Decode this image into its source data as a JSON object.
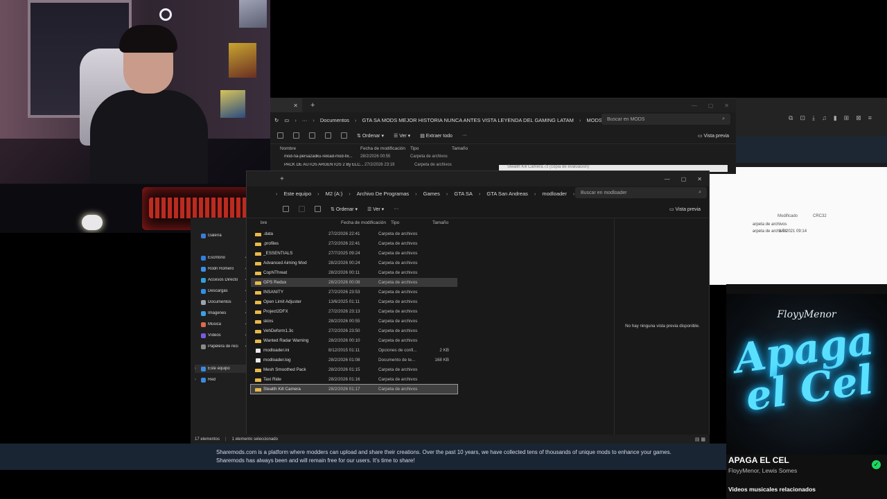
{
  "mods_window": {
    "breadcrumb": [
      "Documentos",
      "GTA SA MODS MEJOR HISTORIA NUNCA ANTES VISTA LEYENDA DEL GAMING LATAM",
      "MODS"
    ],
    "search_placeholder": "Buscar en MODS",
    "cmd": {
      "sort": "Ordenar",
      "view": "Ver",
      "extract": "Extraer todo",
      "preview": "Vista previa"
    },
    "columns": [
      "Nombre",
      "Fecha de modificación",
      "Tipo",
      "Tamaño"
    ],
    "rows": [
      {
        "name": "mod-na-persazadku-reload-mod-fix...",
        "date": "28/2/2026 00:55",
        "type": "Carpeta de archivos"
      },
      {
        "name": "PACK DE AUTOS ARGENTOS 2 By ELC...",
        "date": "27/2/2026 23:19",
        "type": "Carpeta de archivos"
      }
    ]
  },
  "modloader_window": {
    "new_tab": "+",
    "breadcrumb": [
      "Este equipo",
      "M2 (A:)",
      "Archivo De Programas",
      "Games",
      "GTA SA",
      "GTA San Andreas",
      "modloader"
    ],
    "search_placeholder": "Buscar en modloader",
    "cmd": {
      "sort": "Ordenar",
      "view": "Ver",
      "preview": "Vista previa"
    },
    "columns": {
      "name": "bre",
      "date": "Fecha de modificación",
      "type": "Tipo",
      "size": "Tamaño"
    },
    "rows": [
      {
        "name": ".data",
        "date": "27/2/2026 22:41",
        "type": "Carpeta de archivos",
        "size": "",
        "kind": "folder"
      },
      {
        "name": ".profiles",
        "date": "27/2/2026 22:41",
        "type": "Carpeta de archivos",
        "size": "",
        "kind": "folder"
      },
      {
        "name": "_ESSENTIALS",
        "date": "27/7/2025 09:24",
        "type": "Carpeta de archivos",
        "size": "",
        "kind": "folder"
      },
      {
        "name": "Advanced Aiming Mod",
        "date": "28/2/2026 00:24",
        "type": "Carpeta de archivos",
        "size": "",
        "kind": "folder"
      },
      {
        "name": "CopNThreat",
        "date": "28/2/2026 00:11",
        "type": "Carpeta de archivos",
        "size": "",
        "kind": "folder"
      },
      {
        "name": "GPS Redux",
        "date": "28/2/2026 00:08",
        "type": "Carpeta de archivos",
        "size": "",
        "kind": "folder"
      },
      {
        "name": "INSANITY",
        "date": "27/2/2026 23:53",
        "type": "Carpeta de archivos",
        "size": "",
        "kind": "folder"
      },
      {
        "name": "Open Limit Adjuster",
        "date": "13/6/2025 01:11",
        "type": "Carpeta de archivos",
        "size": "",
        "kind": "folder"
      },
      {
        "name": "Project2DFX",
        "date": "27/2/2026 23:13",
        "type": "Carpeta de archivos",
        "size": "",
        "kind": "folder"
      },
      {
        "name": "skins",
        "date": "28/2/2026 00:55",
        "type": "Carpeta de archivos",
        "size": "",
        "kind": "folder"
      },
      {
        "name": "VehDeform1.3c",
        "date": "27/2/2026 23:50",
        "type": "Carpeta de archivos",
        "size": "",
        "kind": "folder"
      },
      {
        "name": "Wanted Radar Warning",
        "date": "28/2/2026 00:10",
        "type": "Carpeta de archivos",
        "size": "",
        "kind": "folder"
      },
      {
        "name": "modloader.ini",
        "date": "8/12/2015 01:11",
        "type": "Opciones de confi...",
        "size": "2 KB",
        "kind": "file"
      },
      {
        "name": "modloader.log",
        "date": "28/2/2026 01:08",
        "type": "Documento de te...",
        "size": "168 KB",
        "kind": "file"
      },
      {
        "name": "Mesh Smoothed Pack",
        "date": "28/2/2026 01:15",
        "type": "Carpeta de archivos",
        "size": "",
        "kind": "folder"
      },
      {
        "name": "Taxi Ride",
        "date": "28/2/2026 01:16",
        "type": "Carpeta de archivos",
        "size": "",
        "kind": "folder"
      },
      {
        "name": "Stealth Kill Camera",
        "date": "28/2/2026 01:17",
        "type": "Carpeta de archivos",
        "size": "",
        "kind": "folder"
      }
    ],
    "no_preview": "No hay ninguna vista previa disponible.",
    "status": {
      "count": "17 elementos",
      "selected": "1 elemento seleccionado"
    }
  },
  "sidebar": {
    "items": [
      {
        "label": "Galería",
        "color": "#3d7bd8"
      },
      {
        "label": "Escritorio",
        "color": "#2f7fe0"
      },
      {
        "label": "Rodri Romero",
        "color": "#3d8fe8"
      },
      {
        "label": "Accesos Directo",
        "color": "#2fa0d8"
      },
      {
        "label": "Descargas",
        "color": "#2f8fe8"
      },
      {
        "label": "Documentos",
        "color": "#9aa4b0"
      },
      {
        "label": "Imágenes",
        "color": "#3aa0e8"
      },
      {
        "label": "Música",
        "color": "#e06a4a"
      },
      {
        "label": "Vídeos",
        "color": "#7a5ae0"
      },
      {
        "label": "Papelera de reci",
        "color": "#8a8a8a"
      },
      {
        "label": "Este equipo",
        "color": "#3a8ae0"
      },
      {
        "label": "Red",
        "color": "#3a8ae0"
      }
    ]
  },
  "background_window": {
    "ghost_title": "Stealth Kill Camera.7z (copia de evaluación)",
    "columns": [
      "Modificado",
      "CRC32"
    ],
    "rows": [
      "arpeta de archivos",
      "arpeta de archivos"
    ],
    "date": "1/7/2021 09:14"
  },
  "sharemods": {
    "text": "Sharemods.com is a platform where modders can upload and share their creations. Over the past 10 years, we have collected tens of thousands of unique mods to enhance your games. Sharemods has always been and will remain free for our users. It's time to share!"
  },
  "music": {
    "cover_artist": "FloyyMenor",
    "cover_title": "Apaga el Cel",
    "title": "APAGA EL CEL",
    "artists": "FloyyMenor, Lewis Somes",
    "related": "Videos musicales relacionados",
    "accent": "#1ed760"
  }
}
